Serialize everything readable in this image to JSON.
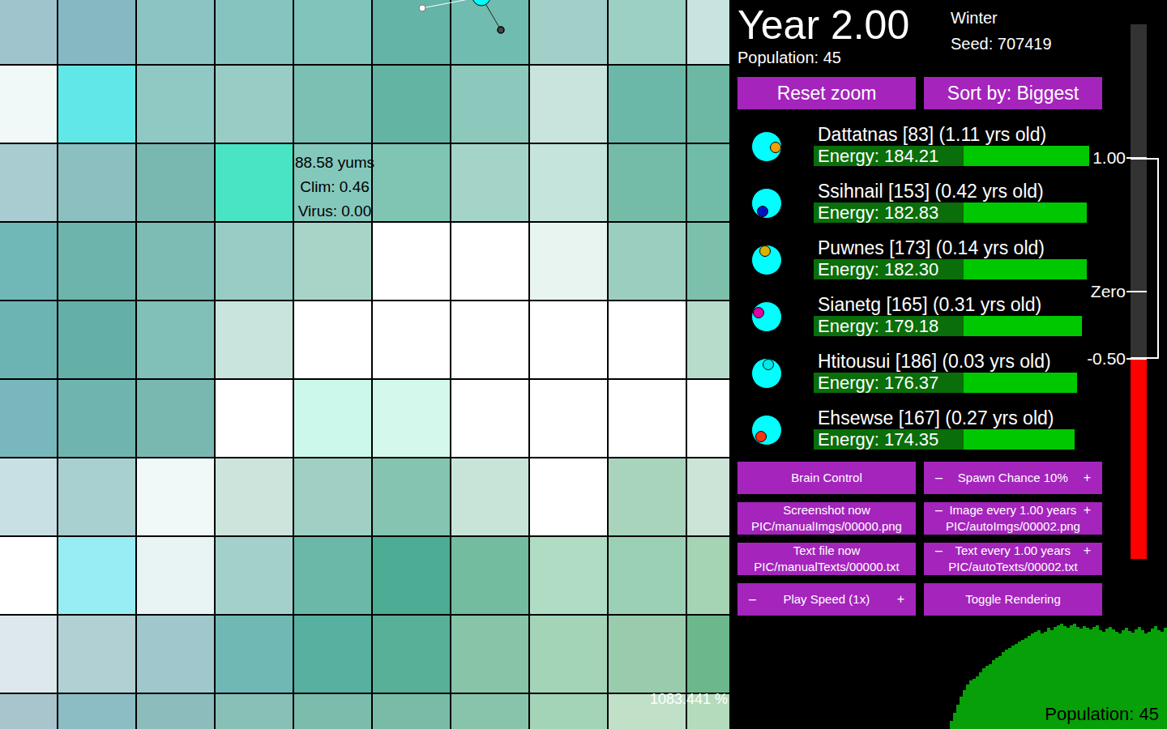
{
  "world": {
    "tiles": [
      [
        "#a0c4cc",
        "#86b8c4",
        "#8cc4c4",
        "#86c4c0",
        "#80c4bc",
        "#64b4a8",
        "#70bcb0",
        "#a0d0c8",
        "#9cd0c4",
        "#c8e4e0"
      ],
      [
        "#f0f8f8",
        "#60e8e8",
        "#90c8c4",
        "#98ccc4",
        "#7cc0b4",
        "#64b4a4",
        "#8cc8bc",
        "#c8e4dc",
        "#6cb8a8",
        "#6cb8a4"
      ],
      [
        "#a8ccd0",
        "#8cc0c0",
        "#78b8b0",
        "#48e4c4",
        "#84c8bc",
        "#80c4b4",
        "#a4d4c8",
        "#c4e4dc",
        "#74bca8",
        "#70bca8"
      ],
      [
        "#70b8b8",
        "#6cb4ac",
        "#7cbcb4",
        "#98ccc4",
        "#a8d4c8",
        "#ffffff",
        "#ffffff",
        "#e8f4f0",
        "#9ccec0",
        "#7cc0ac"
      ],
      [
        "#6cb4b4",
        "#64b0a8",
        "#80c0b8",
        "#c8e4dc",
        "#ffffff",
        "#ffffff",
        "#ffffff",
        "#ffffff",
        "#ffffff",
        "#b8dccc"
      ],
      [
        "#78b8bc",
        "#70b4b0",
        "#78b8b0",
        "#ffffff",
        "#ccf8ec",
        "#d4f8ec",
        "#ffffff",
        "#ffffff",
        "#ffffff",
        "#ffffff"
      ],
      [
        "#c8e0e4",
        "#a8d0d0",
        "#f0f8f8",
        "#cce4dc",
        "#a0d0c4",
        "#84c4b0",
        "#c8e4d8",
        "#ffffff",
        "#a8d4bc",
        "#cce4d8"
      ],
      [
        "#ffffff",
        "#98ecf4",
        "#e8f4f4",
        "#a4d0cc",
        "#6cb8a8",
        "#4cac94",
        "#74bca0",
        "#b0dcc4",
        "#9cd0b4",
        "#a4d4b4"
      ],
      [
        "#dce8ec",
        "#b0d0d4",
        "#a0c8cc",
        "#70b8b4",
        "#58b0a0",
        "#58b098",
        "#88c4a8",
        "#a4d4b8",
        "#98ccac",
        "#6cb88c"
      ],
      [
        "#a8c4cc",
        "#8cbcc4",
        "#8cbcbc",
        "#88c0b8",
        "#7cbcac",
        "#78bca8",
        "#88c4ac",
        "#a4d4b8",
        "#c0e0c8",
        "#b4dcbc"
      ]
    ],
    "tile_info": [
      "88.58 yums",
      "Clim: 0.46",
      "Virus: 0.00"
    ],
    "zoom": "1083.441 %"
  },
  "header": {
    "year": "Year 2.00",
    "season": "Winter",
    "seed": "Seed: 707419",
    "population": "Population: 45"
  },
  "top_buttons": [
    "Reset zoom",
    "Sort by: Biggest"
  ],
  "creatures": [
    {
      "name": "Dattatnas [83] (1.11 yrs old)",
      "energy": "Energy: 184.21",
      "level": 0.921,
      "color": "#f0a000",
      "angle": 5
    },
    {
      "name": "Ssihnail [153] (0.42 yrs old)",
      "energy": "Energy: 182.83",
      "level": 0.914,
      "color": "#0010c0",
      "angle": 120
    },
    {
      "name": "Puwnes [173] (0.14 yrs old)",
      "energy": "Energy: 182.30",
      "level": 0.912,
      "color": "#e0b000",
      "angle": -100
    },
    {
      "name": "Sianetg [165] (0.31 yrs old)",
      "energy": "Energy: 179.18",
      "level": 0.896,
      "color": "#e000a0",
      "angle": 205
    },
    {
      "name": "Htitousui [186] (0.03 yrs old)",
      "energy": "Energy: 176.37",
      "level": 0.882,
      "color": "#00e8e8",
      "angle": -80
    },
    {
      "name": "Ehsewse [167] (0.27 yrs old)",
      "energy": "Energy: 174.35",
      "level": 0.872,
      "color": "#ff3010",
      "angle": 130
    }
  ],
  "controls": [
    {
      "kind": "button",
      "label": "Brain Control"
    },
    {
      "kind": "stepper",
      "minus": "–",
      "label": "Spawn Chance 10%",
      "plus": "+"
    },
    {
      "kind": "button",
      "label": "Screenshot now",
      "path": "PIC/manualImgs/00000.png"
    },
    {
      "kind": "stepper",
      "minus": "–",
      "label": "Image every 1.00 years",
      "plus": "+",
      "path": "PIC/autoImgs/00002.png"
    },
    {
      "kind": "button",
      "label": "Text file now",
      "path": "PIC/manualTexts/00000.txt"
    },
    {
      "kind": "stepper",
      "minus": "–",
      "label": "Text every 1.00 years",
      "plus": "+",
      "path": "PIC/autoTexts/00002.txt"
    },
    {
      "kind": "stepper",
      "minus": "–",
      "label": "Play Speed (1x)",
      "plus": "+"
    },
    {
      "kind": "button",
      "label": "Toggle Rendering"
    }
  ],
  "gauge": {
    "min": -2,
    "max": 2,
    "value": -0.5,
    "level": 0.375,
    "ticks": [
      {
        "label": "1.00",
        "value": 1
      },
      {
        "label": "Zero",
        "value": 0
      },
      {
        "label": "-0.50",
        "value": -0.5
      }
    ],
    "bracket": [
      1,
      -0.5
    ]
  },
  "population_chart": {
    "label": "Population: 45",
    "max": 50,
    "values": [
      3.6,
      7.1,
      10.7,
      14.3,
      17.1,
      19.6,
      21.4,
      22.1,
      23.2,
      25,
      26.8,
      27.9,
      28.6,
      30.4,
      31.4,
      32.1,
      33.9,
      35,
      35.7,
      36.8,
      37.5,
      38.6,
      39.3,
      40,
      41.1,
      42.1,
      42.9,
      43.6,
      42.1,
      42.9,
      44.6,
      43.6,
      45,
      45.7,
      46.4,
      45.4,
      44.6,
      45.7,
      46.4,
      45,
      44.3,
      45.4,
      44.6,
      43.9,
      45,
      45.7,
      43.6,
      42.9,
      44.3,
      45,
      43.9,
      42.9,
      42.1,
      43.6,
      44.6,
      43.2,
      42.5,
      43.9,
      45,
      43.6,
      42.1,
      42.9,
      44.3,
      45.4,
      43.6,
      42.9,
      44.6
    ]
  }
}
